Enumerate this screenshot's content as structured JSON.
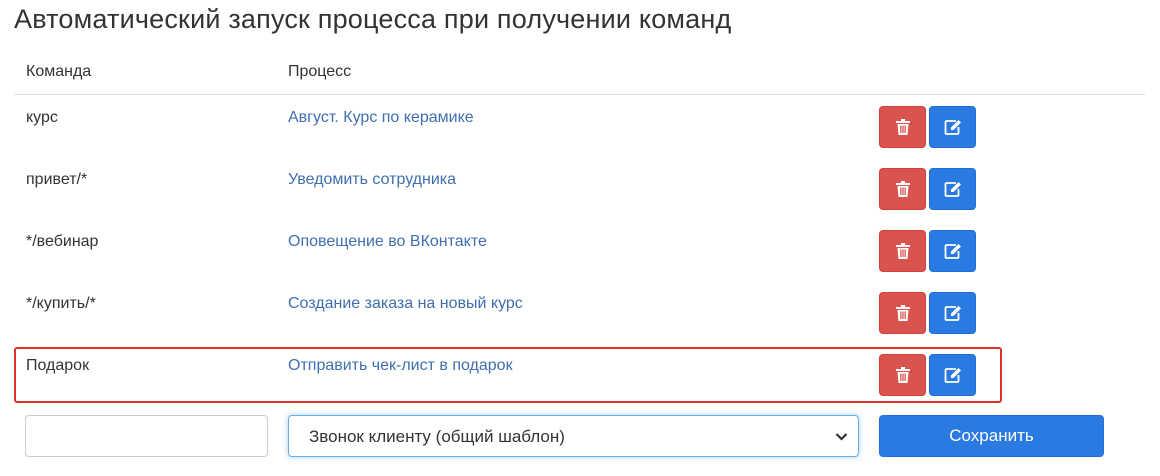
{
  "page": {
    "title": "Автоматический запуск процесса при получении команд"
  },
  "table": {
    "headers": {
      "command": "Команда",
      "process": "Процесс"
    },
    "rows": [
      {
        "command": "курс",
        "process": "Август. Курс по керамике"
      },
      {
        "command": "привет/*",
        "process": "Уведомить сотрудника"
      },
      {
        "command": "*/вебинар",
        "process": "Оповещение во ВКонтакте"
      },
      {
        "command": "*/купить/*",
        "process": "Создание заказа на новый курс"
      },
      {
        "command": "Подарок",
        "process": "Отправить чек-лист в подарок"
      }
    ]
  },
  "form": {
    "command_value": "",
    "process_selected": "Звонок клиенту (общий шаблон)",
    "save_label": "Сохранить"
  },
  "icons": {
    "delete": "trash-icon",
    "edit": "edit-icon",
    "select": "chevron-down-icon"
  },
  "colors": {
    "danger": "#d9534f",
    "primary": "#2a7ae2",
    "link": "#3f6fb0",
    "highlight": "#e0302b"
  }
}
